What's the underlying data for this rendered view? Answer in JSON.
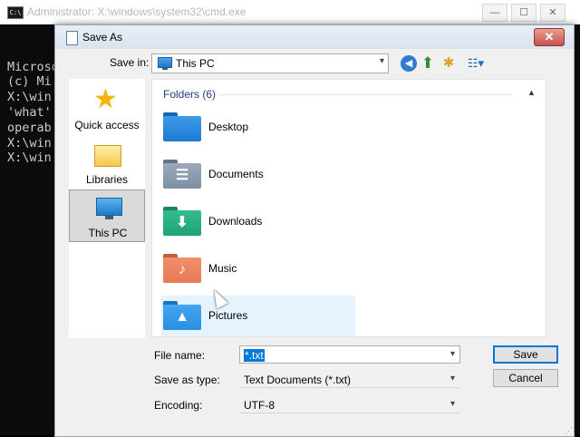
{
  "console": {
    "title": "Administrator: X:\\windows\\system32\\cmd.exe",
    "icon_text": "C:\\",
    "icon": "console-icon",
    "minimize_glyph": "—",
    "maximize_glyph": "☐",
    "close_glyph": "✕",
    "lines": [
      "Microso",
      "(c) Mi",
      "",
      "X:\\win",
      "'what'",
      "operab",
      "",
      "X:\\win",
      "",
      "X:\\win"
    ]
  },
  "dialog": {
    "title": "Save As",
    "close_glyph": "✕",
    "toolbar": {
      "save_in_label": "Save in:",
      "save_in_value": "This PC",
      "back_glyph": "◀",
      "up_glyph": "⬆",
      "new_folder_glyph": "✱",
      "view_glyph": "☷▾",
      "dropdown_glyph": "▾"
    },
    "places": [
      {
        "label": "Quick access",
        "icon": "star-icon",
        "glyph": "★"
      },
      {
        "label": "Libraries",
        "icon": "libraries-icon"
      },
      {
        "label": "This PC",
        "icon": "this-pc-icon",
        "selected": true
      }
    ],
    "group": {
      "label": "Folders (6)",
      "collapse_glyph": "▲"
    },
    "folders": [
      {
        "name": "Desktop",
        "color": "#1f7ad1",
        "tab": "#1565b4",
        "glyph": ""
      },
      {
        "name": "Documents",
        "color": "#7f8fa3",
        "tab": "#667488",
        "glyph": "☰"
      },
      {
        "name": "Downloads",
        "color": "#1fa37a",
        "tab": "#178763",
        "glyph": "⬇"
      },
      {
        "name": "Music",
        "color": "#e47a54",
        "tab": "#c65e3b",
        "glyph": "♪"
      },
      {
        "name": "Pictures",
        "color": "#2a8fe0",
        "tab": "#1d73bd",
        "glyph": "▲",
        "hover": true
      }
    ],
    "filename": {
      "label": "File name:",
      "value": "*.txt"
    },
    "savetype": {
      "label": "Save as type:",
      "value": "Text Documents (*.txt)"
    },
    "encoding": {
      "label": "Encoding:",
      "value": "UTF-8"
    },
    "buttons": {
      "save": "Save",
      "cancel": "Cancel"
    },
    "grip_glyph": "⋰"
  },
  "colors": {
    "accent": "#0078d7",
    "group_header": "#1e3a8a",
    "close_button": "#c75050"
  }
}
